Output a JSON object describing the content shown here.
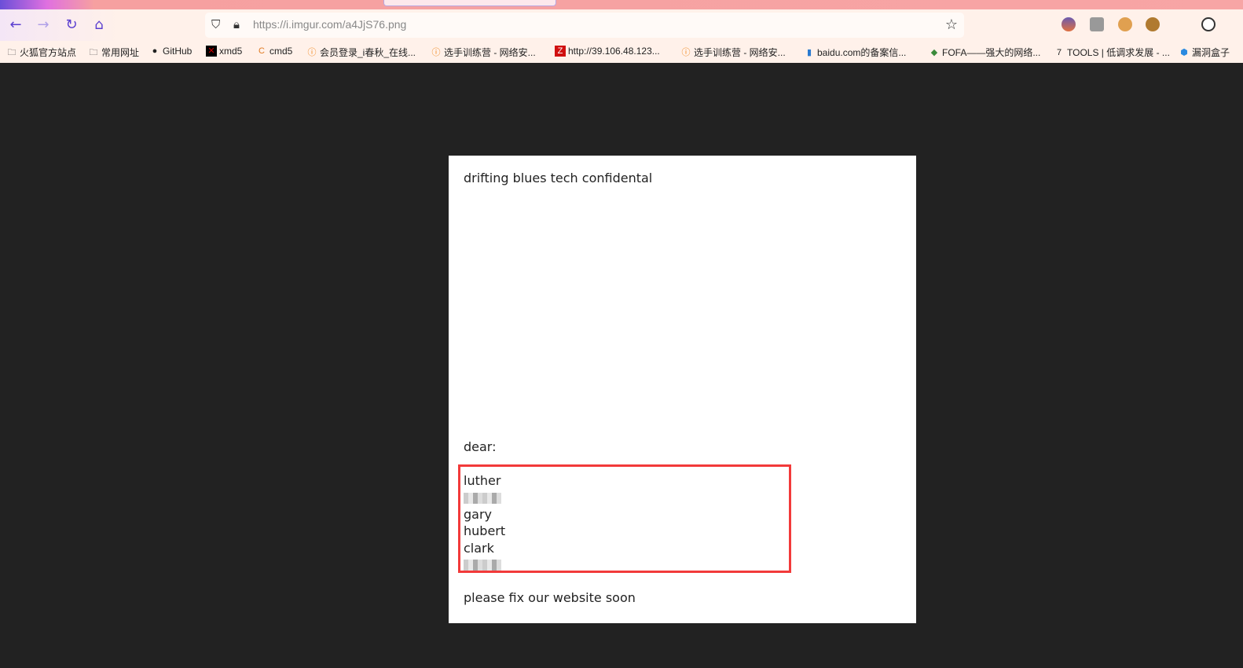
{
  "browser": {
    "url_host": "https://i.imgur.com",
    "url_host_bold": "imgur.com",
    "url_path": "/a4JjS76.png",
    "url": "https://i.imgur.com/a4JjS76.png",
    "bookmarks": [
      {
        "label": "火狐官方站点",
        "icon": "folder-icon"
      },
      {
        "label": "常用网址",
        "icon": "folder-icon"
      },
      {
        "label": "GitHub",
        "icon": "github-icon"
      },
      {
        "label": "xmd5",
        "icon": "xmd5-icon"
      },
      {
        "label": "cmd5",
        "icon": "cmd5-icon"
      },
      {
        "label": "会员登录_i春秋_在线...",
        "icon": "ichunqiu-icon"
      },
      {
        "label": "选手训练营 - 网络安...",
        "icon": "ichunqiu-icon"
      },
      {
        "label": "http://39.106.48.123...",
        "icon": "z-icon"
      },
      {
        "label": "选手训练营 - 网络安...",
        "icon": "ichunqiu-icon"
      },
      {
        "label": "baidu.com的备案信...",
        "icon": "baidu-icon"
      },
      {
        "label": "FOFA——强大的网络...",
        "icon": "fofa-icon"
      },
      {
        "label": "TOOLS | 低调求发展 - ...",
        "icon": "tools-icon"
      },
      {
        "label": "漏洞盒子",
        "icon": "vulbox-icon"
      }
    ]
  },
  "document": {
    "title": "drifting blues tech confidental",
    "greeting": "dear:",
    "names": [
      "luther",
      "gary",
      "hubert",
      "clark"
    ],
    "closing": "please fix our website soon",
    "highlight_color": "#f23a3a"
  }
}
